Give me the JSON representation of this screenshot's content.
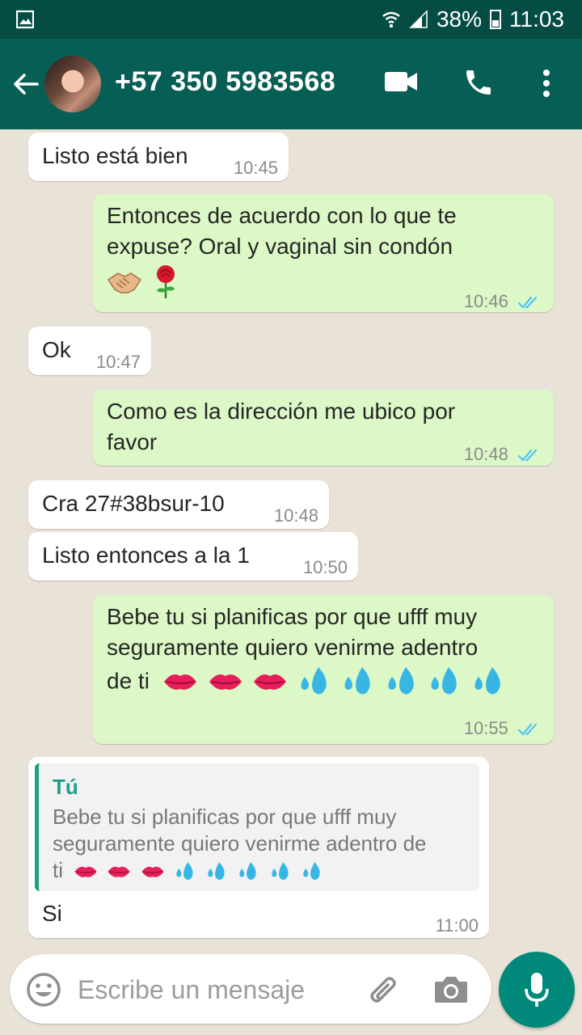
{
  "status_bar": {
    "battery": "38%",
    "time": "11:03"
  },
  "header": {
    "contact": "+57 350 5983568"
  },
  "messages": [
    {
      "dir": "in",
      "text": "Listo está bien",
      "time": "10:45"
    },
    {
      "dir": "out",
      "line1": "Entonces de acuerdo con lo que te",
      "line2": "expuse?   Oral y vaginal sin condón",
      "emojis": [
        "handshake",
        "rose"
      ],
      "time": "10:46"
    },
    {
      "dir": "in",
      "text": "Ok",
      "time": "10:47"
    },
    {
      "dir": "out",
      "line1": "Como es la dirección me ubico por",
      "line2": "favor",
      "time": "10:48"
    },
    {
      "dir": "in",
      "text": "Cra 27#38bsur-10",
      "time": "10:48"
    },
    {
      "dir": "in",
      "text": "Listo entonces a la 1",
      "time": "10:50"
    },
    {
      "dir": "out",
      "line1": "Bebe tu si planificas por que ufff muy",
      "line2": "seguramente quiero venirme adentro",
      "line3": "de ti",
      "emojis": [
        "kiss",
        "kiss",
        "kiss",
        "drops",
        "drops",
        "drops",
        "drops",
        "drops"
      ],
      "time": "10:55"
    },
    {
      "dir": "in",
      "quote_author": "Tú",
      "quote_line1": "Bebe tu si planificas por que ufff muy",
      "quote_line2": "seguramente quiero venirme adentro de",
      "quote_line3": "ti",
      "text": "Si",
      "time": "11:00"
    }
  ],
  "composer": {
    "placeholder": "Escribe un mensaje"
  },
  "colors": {
    "header": "#075e54",
    "status_bar": "#054d44",
    "outgoing": "#dcf8c6",
    "incoming": "#ffffff",
    "accent": "#00897b",
    "read_ticks": "#4fc3f7"
  },
  "icons": [
    "image-icon",
    "wifi-icon",
    "signal-icon",
    "battery-icon",
    "back-arrow-icon",
    "video-call-icon",
    "phone-icon",
    "more-vert-icon",
    "read-ticks-icon",
    "emoji-icon",
    "attach-icon",
    "camera-icon",
    "mic-icon"
  ]
}
